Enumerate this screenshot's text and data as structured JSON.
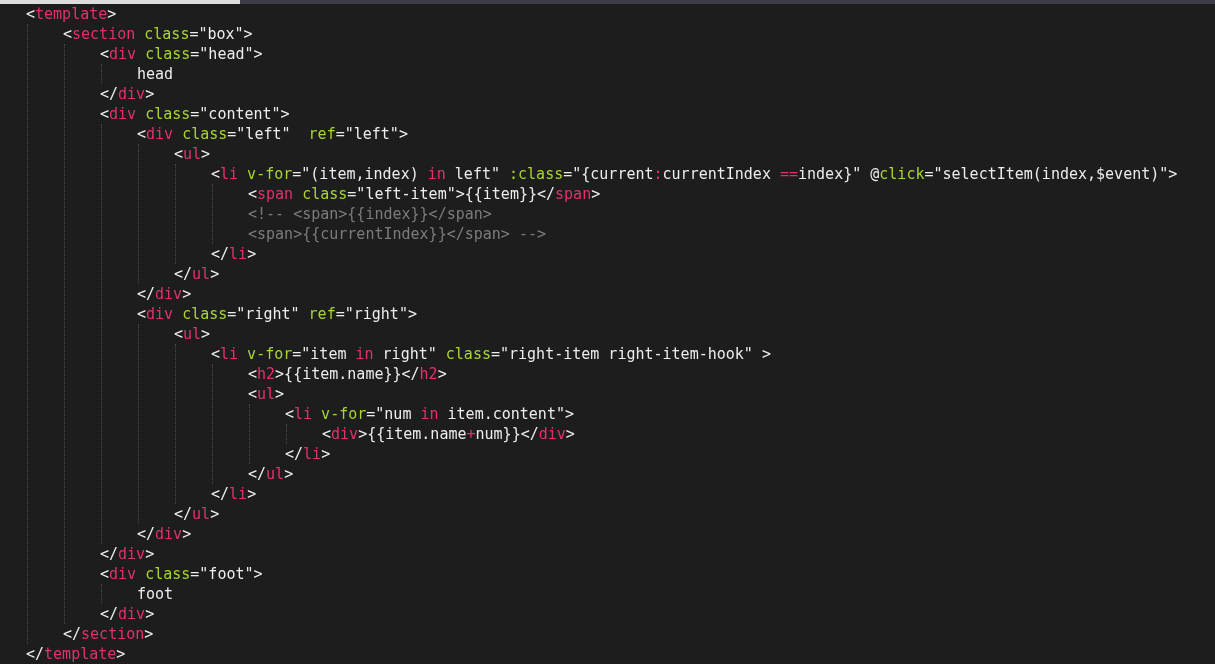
{
  "editor": {
    "lines": [
      {
        "tokens": [
          {
            "kind": "plain",
            "text": "<"
          },
          {
            "kind": "tag",
            "text": "template"
          },
          {
            "kind": "plain",
            "text": ">"
          }
        ],
        "children": [
          {
            "tokens": [
              {
                "kind": "plain",
                "text": "<"
              },
              {
                "kind": "tag",
                "text": "section"
              },
              {
                "kind": "attr",
                "text": " class"
              },
              {
                "kind": "plain",
                "text": "=\"box\">"
              }
            ],
            "children": [
              {
                "tokens": [
                  {
                    "kind": "plain",
                    "text": "<"
                  },
                  {
                    "kind": "tag",
                    "text": "div"
                  },
                  {
                    "kind": "attr",
                    "text": " class"
                  },
                  {
                    "kind": "plain",
                    "text": "=\"head\">"
                  }
                ],
                "children": [
                  {
                    "tokens": [
                      {
                        "kind": "plain",
                        "text": "head"
                      }
                    ]
                  }
                ]
              },
              {
                "tokens": [
                  {
                    "kind": "plain",
                    "text": "</"
                  },
                  {
                    "kind": "tag",
                    "text": "div"
                  },
                  {
                    "kind": "plain",
                    "text": ">"
                  }
                ]
              },
              {
                "tokens": [
                  {
                    "kind": "plain",
                    "text": "<"
                  },
                  {
                    "kind": "tag",
                    "text": "div"
                  },
                  {
                    "kind": "attr",
                    "text": " class"
                  },
                  {
                    "kind": "plain",
                    "text": "=\"content\">"
                  }
                ],
                "children": [
                  {
                    "tokens": [
                      {
                        "kind": "plain",
                        "text": "<"
                      },
                      {
                        "kind": "tag",
                        "text": "div"
                      },
                      {
                        "kind": "attr",
                        "text": " class"
                      },
                      {
                        "kind": "plain",
                        "text": "=\"left\"  "
                      },
                      {
                        "kind": "attr",
                        "text": "ref"
                      },
                      {
                        "kind": "plain",
                        "text": "=\"left\">"
                      }
                    ],
                    "children": [
                      {
                        "tokens": [
                          {
                            "kind": "plain",
                            "text": "<"
                          },
                          {
                            "kind": "tag",
                            "text": "ul"
                          },
                          {
                            "kind": "plain",
                            "text": ">"
                          }
                        ],
                        "children": [
                          {
                            "tokens": [
                              {
                                "kind": "plain",
                                "text": "<"
                              },
                              {
                                "kind": "tag",
                                "text": "li"
                              },
                              {
                                "kind": "attr",
                                "text": " v-for"
                              },
                              {
                                "kind": "plain",
                                "text": "=\"(item,index) "
                              },
                              {
                                "kind": "keyword",
                                "text": "in"
                              },
                              {
                                "kind": "plain",
                                "text": " left\" "
                              },
                              {
                                "kind": "attr",
                                "text": ":class"
                              },
                              {
                                "kind": "plain",
                                "text": "=\"{current"
                              },
                              {
                                "kind": "keyword",
                                "text": ":"
                              },
                              {
                                "kind": "plain",
                                "text": "currentIndex "
                              },
                              {
                                "kind": "keyword",
                                "text": "=="
                              },
                              {
                                "kind": "plain",
                                "text": "index}\" @"
                              },
                              {
                                "kind": "attr",
                                "text": "click"
                              },
                              {
                                "kind": "plain",
                                "text": "=\"selectItem(index,$event)\">"
                              }
                            ],
                            "children": [
                              {
                                "tokens": [
                                  {
                                    "kind": "plain",
                                    "text": "<"
                                  },
                                  {
                                    "kind": "tag",
                                    "text": "span"
                                  },
                                  {
                                    "kind": "attr",
                                    "text": " class"
                                  },
                                  {
                                    "kind": "plain",
                                    "text": "=\"left-item\">{{item}}</"
                                  },
                                  {
                                    "kind": "tag",
                                    "text": "span"
                                  },
                                  {
                                    "kind": "plain",
                                    "text": ">"
                                  }
                                ]
                              },
                              {
                                "tokens": [
                                  {
                                    "kind": "comment",
                                    "text": "<!-- <span>{{index}}</span>"
                                  }
                                ]
                              },
                              {
                                "tokens": [
                                  {
                                    "kind": "comment",
                                    "text": "<span>{{currentIndex}}</span> -->"
                                  }
                                ]
                              }
                            ]
                          },
                          {
                            "tokens": [
                              {
                                "kind": "plain",
                                "text": "</"
                              },
                              {
                                "kind": "tag",
                                "text": "li"
                              },
                              {
                                "kind": "plain",
                                "text": ">"
                              }
                            ]
                          }
                        ]
                      },
                      {
                        "tokens": [
                          {
                            "kind": "plain",
                            "text": "</"
                          },
                          {
                            "kind": "tag",
                            "text": "ul"
                          },
                          {
                            "kind": "plain",
                            "text": ">"
                          }
                        ]
                      }
                    ]
                  },
                  {
                    "tokens": [
                      {
                        "kind": "plain",
                        "text": "</"
                      },
                      {
                        "kind": "tag",
                        "text": "div"
                      },
                      {
                        "kind": "plain",
                        "text": ">"
                      }
                    ]
                  },
                  {
                    "tokens": [
                      {
                        "kind": "plain",
                        "text": "<"
                      },
                      {
                        "kind": "tag",
                        "text": "div"
                      },
                      {
                        "kind": "attr",
                        "text": " class"
                      },
                      {
                        "kind": "plain",
                        "text": "=\"right\" "
                      },
                      {
                        "kind": "attr",
                        "text": "ref"
                      },
                      {
                        "kind": "plain",
                        "text": "=\"right\">"
                      }
                    ],
                    "children": [
                      {
                        "tokens": [
                          {
                            "kind": "plain",
                            "text": "<"
                          },
                          {
                            "kind": "tag",
                            "text": "ul"
                          },
                          {
                            "kind": "plain",
                            "text": ">"
                          }
                        ],
                        "children": [
                          {
                            "tokens": [
                              {
                                "kind": "plain",
                                "text": "<"
                              },
                              {
                                "kind": "tag",
                                "text": "li"
                              },
                              {
                                "kind": "attr",
                                "text": " v-for"
                              },
                              {
                                "kind": "plain",
                                "text": "=\"item "
                              },
                              {
                                "kind": "keyword",
                                "text": "in"
                              },
                              {
                                "kind": "plain",
                                "text": " right\" "
                              },
                              {
                                "kind": "attr",
                                "text": "class"
                              },
                              {
                                "kind": "plain",
                                "text": "=\"right-item right-item-hook\" >"
                              }
                            ],
                            "children": [
                              {
                                "tokens": [
                                  {
                                    "kind": "plain",
                                    "text": "<"
                                  },
                                  {
                                    "kind": "tag",
                                    "text": "h2"
                                  },
                                  {
                                    "kind": "plain",
                                    "text": ">{{item.name}}</"
                                  },
                                  {
                                    "kind": "tag",
                                    "text": "h2"
                                  },
                                  {
                                    "kind": "plain",
                                    "text": ">"
                                  }
                                ]
                              },
                              {
                                "tokens": [
                                  {
                                    "kind": "plain",
                                    "text": "<"
                                  },
                                  {
                                    "kind": "tag",
                                    "text": "ul"
                                  },
                                  {
                                    "kind": "plain",
                                    "text": ">"
                                  }
                                ],
                                "children": [
                                  {
                                    "tokens": [
                                      {
                                        "kind": "plain",
                                        "text": "<"
                                      },
                                      {
                                        "kind": "tag",
                                        "text": "li"
                                      },
                                      {
                                        "kind": "attr",
                                        "text": " v-for"
                                      },
                                      {
                                        "kind": "plain",
                                        "text": "=\"num "
                                      },
                                      {
                                        "kind": "keyword",
                                        "text": "in"
                                      },
                                      {
                                        "kind": "plain",
                                        "text": " item.content\">"
                                      }
                                    ],
                                    "children": [
                                      {
                                        "tokens": [
                                          {
                                            "kind": "plain",
                                            "text": "<"
                                          },
                                          {
                                            "kind": "tag",
                                            "text": "div"
                                          },
                                          {
                                            "kind": "plain",
                                            "text": ">{{item.name"
                                          },
                                          {
                                            "kind": "keyword",
                                            "text": "+"
                                          },
                                          {
                                            "kind": "plain",
                                            "text": "num}}</"
                                          },
                                          {
                                            "kind": "tag",
                                            "text": "div"
                                          },
                                          {
                                            "kind": "plain",
                                            "text": ">"
                                          }
                                        ]
                                      }
                                    ]
                                  },
                                  {
                                    "tokens": [
                                      {
                                        "kind": "plain",
                                        "text": "</"
                                      },
                                      {
                                        "kind": "tag",
                                        "text": "li"
                                      },
                                      {
                                        "kind": "plain",
                                        "text": ">"
                                      }
                                    ]
                                  }
                                ]
                              },
                              {
                                "tokens": [
                                  {
                                    "kind": "plain",
                                    "text": "</"
                                  },
                                  {
                                    "kind": "tag",
                                    "text": "ul"
                                  },
                                  {
                                    "kind": "plain",
                                    "text": ">"
                                  }
                                ]
                              }
                            ]
                          },
                          {
                            "tokens": [
                              {
                                "kind": "plain",
                                "text": "</"
                              },
                              {
                                "kind": "tag",
                                "text": "li"
                              },
                              {
                                "kind": "plain",
                                "text": ">"
                              }
                            ]
                          }
                        ]
                      },
                      {
                        "tokens": [
                          {
                            "kind": "plain",
                            "text": "</"
                          },
                          {
                            "kind": "tag",
                            "text": "ul"
                          },
                          {
                            "kind": "plain",
                            "text": ">"
                          }
                        ]
                      }
                    ]
                  },
                  {
                    "tokens": [
                      {
                        "kind": "plain",
                        "text": "</"
                      },
                      {
                        "kind": "tag",
                        "text": "div"
                      },
                      {
                        "kind": "plain",
                        "text": ">"
                      }
                    ]
                  }
                ]
              },
              {
                "tokens": [
                  {
                    "kind": "plain",
                    "text": "</"
                  },
                  {
                    "kind": "tag",
                    "text": "div"
                  },
                  {
                    "kind": "plain",
                    "text": ">"
                  }
                ]
              },
              {
                "tokens": [
                  {
                    "kind": "plain",
                    "text": "<"
                  },
                  {
                    "kind": "tag",
                    "text": "div"
                  },
                  {
                    "kind": "attr",
                    "text": " class"
                  },
                  {
                    "kind": "plain",
                    "text": "=\"foot\">"
                  }
                ],
                "children": [
                  {
                    "tokens": [
                      {
                        "kind": "plain",
                        "text": "foot"
                      }
                    ]
                  }
                ]
              },
              {
                "tokens": [
                  {
                    "kind": "plain",
                    "text": "</"
                  },
                  {
                    "kind": "tag",
                    "text": "div"
                  },
                  {
                    "kind": "plain",
                    "text": ">"
                  }
                ]
              }
            ]
          },
          {
            "tokens": [
              {
                "kind": "plain",
                "text": "</"
              },
              {
                "kind": "tag",
                "text": "section"
              },
              {
                "kind": "plain",
                "text": ">"
              }
            ]
          }
        ]
      },
      {
        "tokens": [
          {
            "kind": "plain",
            "text": "</"
          },
          {
            "kind": "tag",
            "text": "template"
          },
          {
            "kind": "plain",
            "text": ">"
          }
        ]
      }
    ]
  }
}
